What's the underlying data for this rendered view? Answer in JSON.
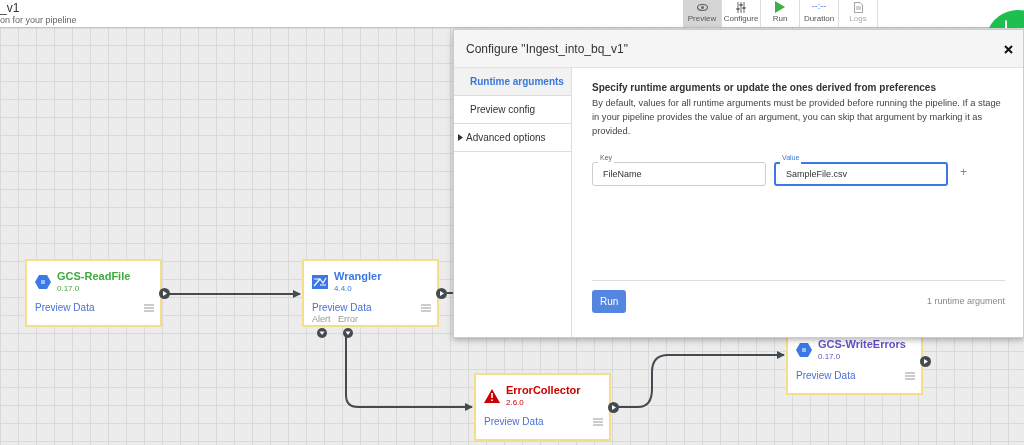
{
  "header": {
    "title": "_v1",
    "subtitle": "on for your pipeline"
  },
  "toolbar": [
    {
      "label": "Preview",
      "selected": true,
      "disabled": false
    },
    {
      "label": "Configure",
      "selected": false,
      "disabled": false
    },
    {
      "label": "Run",
      "selected": false,
      "disabled": false
    },
    {
      "label": "Duration",
      "value": "--:--",
      "selected": false,
      "disabled": false
    },
    {
      "label": "Logs",
      "selected": false,
      "disabled": true
    }
  ],
  "nodes": [
    {
      "kind": "source",
      "name": "GCS-ReadFile",
      "version": "0.17.0",
      "link": "Preview Data",
      "color": "#3dab3d"
    },
    {
      "kind": "transform",
      "name": "Wrangler",
      "version": "4.4.0",
      "link": "Preview Data",
      "color": "#3b78e7",
      "ports": [
        "Alert",
        "Error"
      ]
    },
    {
      "kind": "error",
      "name": "ErrorCollector",
      "version": "2.6.0",
      "link": "Preview Data",
      "color": "#cc0000"
    },
    {
      "kind": "sink",
      "name": "GCS-WriteErrors",
      "version": "0.17.0",
      "link": "Preview Data",
      "color": "#6a4fc9"
    }
  ],
  "modal": {
    "title": "Configure \"Ingest_into_bq_v1\"",
    "nav": [
      {
        "kind": "tab",
        "label": "Runtime arguments",
        "selected": true
      },
      {
        "kind": "tab",
        "label": "Preview config",
        "selected": false
      },
      {
        "kind": "expander",
        "label": "Advanced options",
        "selected": false,
        "expanded": false
      }
    ],
    "heading": "Specify runtime arguments or update the ones derived from preferences",
    "description": "By default, values for all runtime arguments must be provided before running the pipeline. If a stage in your pipeline provides the value of an argument, you can skip that argument by marking it as provided.",
    "arguments": [
      {
        "key_label": "Key",
        "key": "FileName",
        "value_label": "Value",
        "value": "SampleFile.csv",
        "focused": true
      }
    ],
    "add_button": "+",
    "run_button": "Run",
    "count": "1 runtime argument"
  }
}
